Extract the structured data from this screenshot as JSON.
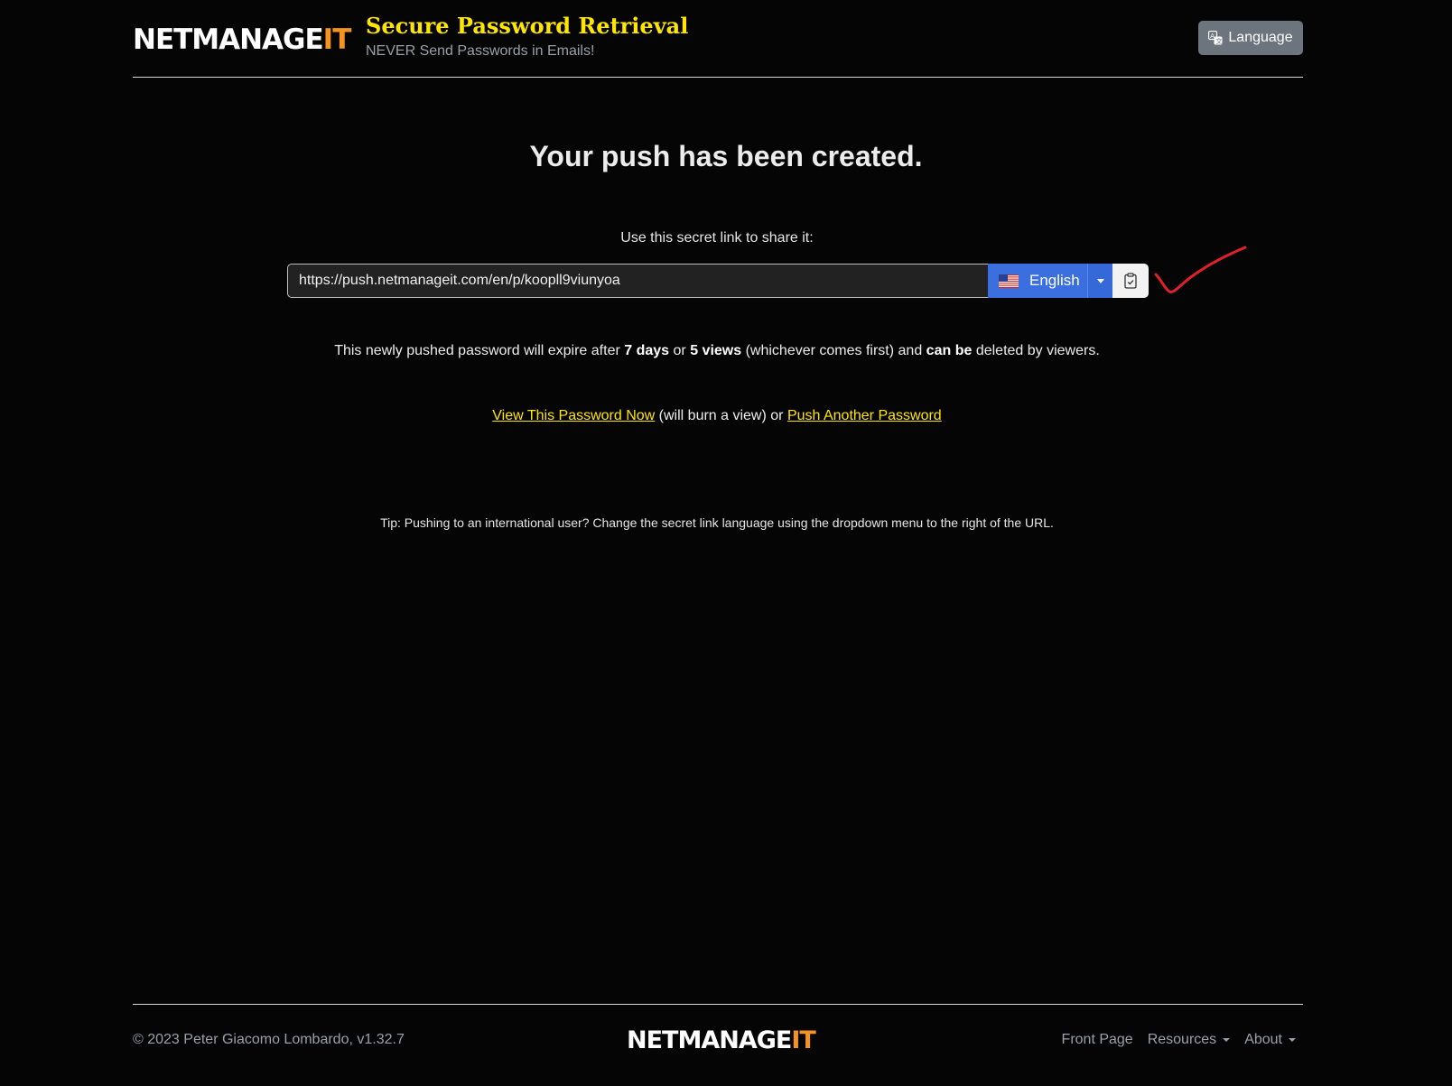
{
  "header": {
    "logo_main": "NETMANAGE",
    "logo_accent": "IT",
    "brand_title": "Secure Password Retrieval",
    "brand_subtitle": "NEVER Send Passwords in Emails!",
    "language_button": "Language"
  },
  "main": {
    "headline": "Your push has been created.",
    "share_label": "Use this secret link to share it:",
    "secret_url": "https://push.netmanageit.com/en/p/koopll9viunyoa",
    "link_language": "English",
    "expire": {
      "prefix": "This newly pushed password will expire after",
      "days": "7 days",
      "or": "or",
      "views": "5 views",
      "middle": "(whichever comes first) and",
      "can_be": "can be",
      "suffix": "deleted by viewers."
    },
    "links": {
      "view_now": "View This Password Now",
      "burn_note": "(will burn a view) or",
      "push_another": "Push Another Password"
    },
    "tip": "Tip: Pushing to an international user? Change the secret link language using the dropdown menu to the right of the URL."
  },
  "footer": {
    "copyright": "© 2023 Peter Giacomo Lombardo, v1.32.7",
    "logo_main": "NETMANAGE",
    "logo_accent": "IT",
    "nav": {
      "front_page": "Front Page",
      "resources": "Resources",
      "about": "About"
    }
  },
  "colors": {
    "accent_yellow": "#ffe600",
    "logo_orange": "#f29322",
    "primary_blue": "#3b6fe0",
    "annotation_red": "#e0202a"
  },
  "icons": {
    "language": "translate-icon",
    "flag": "us-flag-icon",
    "copy": "clipboard-check-icon",
    "annotation": "checkmark-annotation"
  }
}
